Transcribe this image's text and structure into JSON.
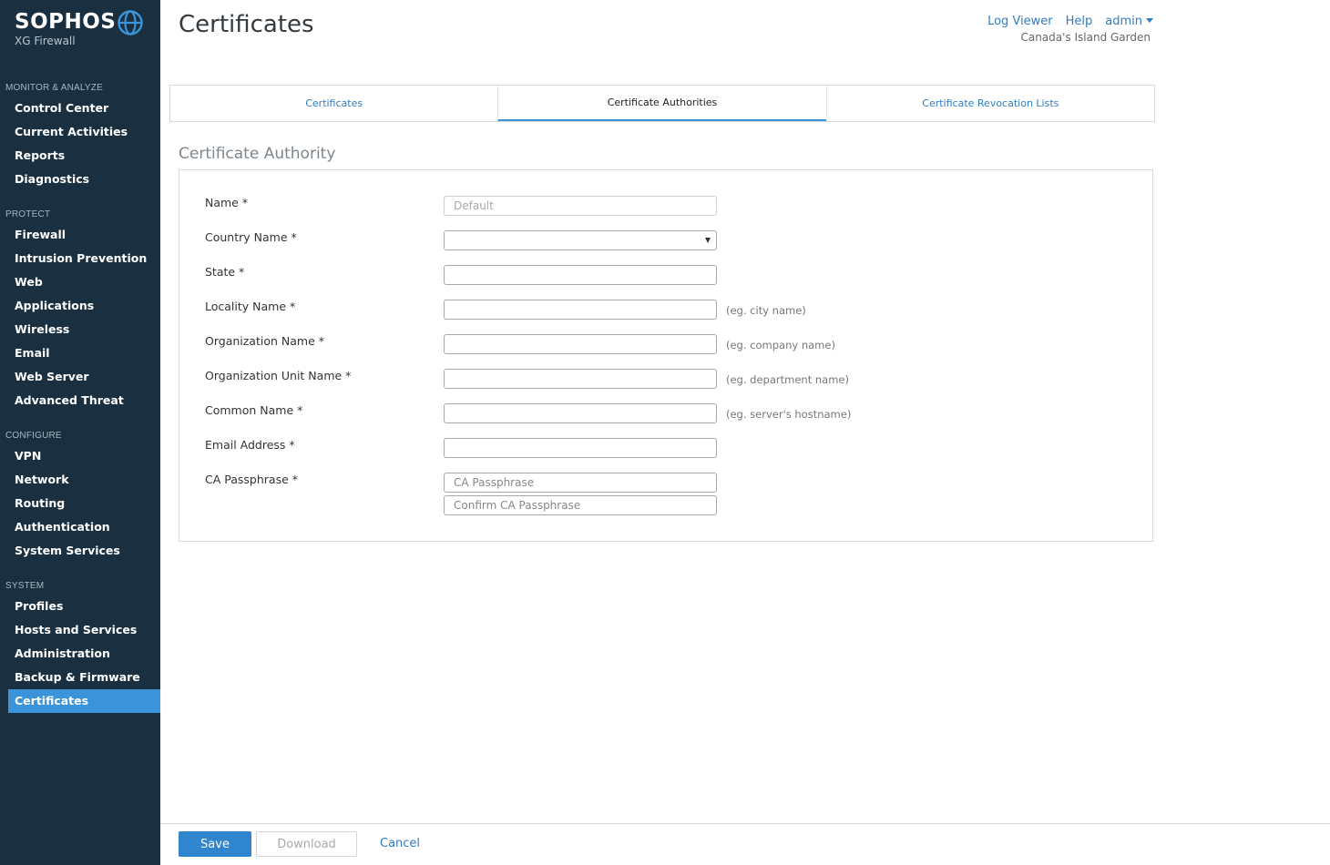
{
  "brand": {
    "name": "SOPHOS",
    "product": "XG Firewall"
  },
  "sidebar": {
    "sections": [
      {
        "label": "MONITOR & ANALYZE",
        "items": [
          "Control Center",
          "Current Activities",
          "Reports",
          "Diagnostics"
        ]
      },
      {
        "label": "PROTECT",
        "items": [
          "Firewall",
          "Intrusion Prevention",
          "Web",
          "Applications",
          "Wireless",
          "Email",
          "Web Server",
          "Advanced Threat"
        ]
      },
      {
        "label": "CONFIGURE",
        "items": [
          "VPN",
          "Network",
          "Routing",
          "Authentication",
          "System Services"
        ]
      },
      {
        "label": "SYSTEM",
        "items": [
          "Profiles",
          "Hosts and Services",
          "Administration",
          "Backup & Firmware",
          "Certificates"
        ]
      }
    ],
    "active_item": "Certificates"
  },
  "header": {
    "title": "Certificates",
    "log_viewer": "Log Viewer",
    "help": "Help",
    "user": "admin",
    "org_name": "Canada's Island Garden"
  },
  "tabs": [
    {
      "label": "Certificates",
      "active": false
    },
    {
      "label": "Certificate Authorities",
      "active": true
    },
    {
      "label": "Certificate Revocation Lists",
      "active": false
    }
  ],
  "form": {
    "section_title": "Certificate Authority",
    "fields": {
      "name": {
        "label": "Name *",
        "placeholder": "Default"
      },
      "country": {
        "label": "Country Name *",
        "value": ""
      },
      "state": {
        "label": "State *",
        "value": ""
      },
      "locality": {
        "label": "Locality Name *",
        "value": "",
        "hint": "(eg. city name)"
      },
      "organization": {
        "label": "Organization Name *",
        "value": "",
        "hint": "(eg. company name)"
      },
      "org_unit": {
        "label": "Organization Unit Name *",
        "value": "",
        "hint": "(eg. department name)"
      },
      "common_name": {
        "label": "Common Name *",
        "value": "",
        "hint": "(eg. server's hostname)"
      },
      "email": {
        "label": "Email Address *",
        "value": ""
      },
      "passphrase": {
        "label": "CA Passphrase *",
        "placeholder": "CA Passphrase",
        "confirm_placeholder": "Confirm CA Passphrase"
      }
    }
  },
  "footer": {
    "save": "Save",
    "download": "Download",
    "cancel": "Cancel"
  },
  "colors": {
    "sidebar_bg": "#1a3040",
    "accent": "#3b94d9",
    "link": "#2f7cc1"
  }
}
